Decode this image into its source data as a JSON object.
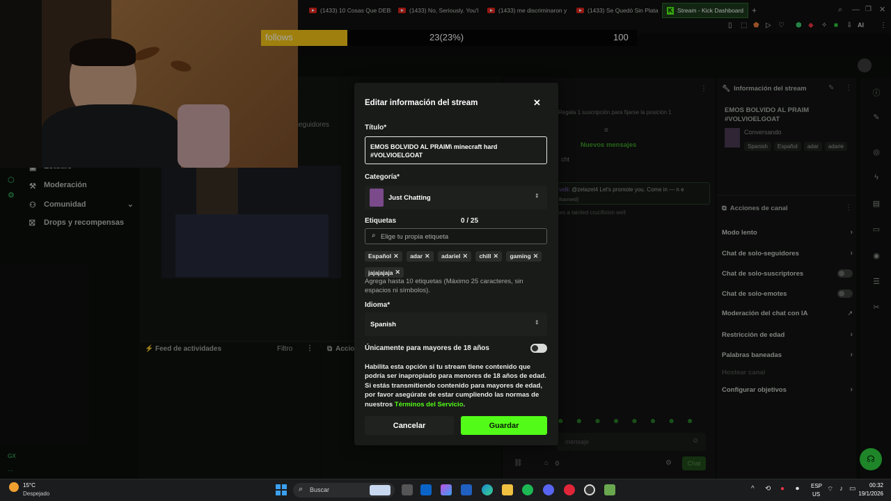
{
  "browser": {
    "tabs": [
      {
        "label": "(1433) 10 Cosas Que DEBE"
      },
      {
        "label": "(1433) No, Seriously. You'l"
      },
      {
        "label": "(1433) me discriminaron y"
      },
      {
        "label": "(1433) Se Quedó Sin Plata"
      },
      {
        "label": "Stream - Kick Dashboard"
      }
    ],
    "new_tab": "+",
    "ai_label": "AI"
  },
  "overlay": {
    "follows_label": "follows",
    "follows_count": "23(23%)",
    "follows_goal": "100",
    "progress_fraction": 0.23
  },
  "sidebar": {
    "items": [
      {
        "label": "Estudio"
      },
      {
        "label": "Moderación"
      },
      {
        "label": "Comunidad"
      },
      {
        "label": "Drops y recompensas"
      }
    ],
    "seguidores": "seguidores",
    "gx_label": "GX"
  },
  "center": {
    "feed_title": "Feed de actividades",
    "feed_filter": "Filtro",
    "acciones_title": "Accio"
  },
  "chat": {
    "gift_text": "Regala 1 suscripción para fijarse la posición 1",
    "new_messages": "Nuevos mensajes",
    "msg1": "cht",
    "msg2_user": "velli:",
    "msg2_text": "@zelazet4 Let's promote you. Come in — n e",
    "msg2_status": "Banned)",
    "msg3": "wo a tainted crucifixion well",
    "input_placeholder": "mensaje",
    "send_label": "Chat",
    "viewer_count": "0"
  },
  "stream_info": {
    "title": "Información del stream",
    "stream_title": "EMOS BOLVIDO AL PRAIM #VOLVIOELGOAT",
    "category": "Conversando",
    "tags": [
      "Spanish",
      "Español",
      "adar",
      "adarie"
    ]
  },
  "channel_actions": {
    "title": "Acciones de canal",
    "items": [
      {
        "label": "Modo lento"
      },
      {
        "label": "Chat de solo-seguidores"
      },
      {
        "label": "Chat de solo-suscriptores"
      },
      {
        "label": "Chat de solo-emotes"
      },
      {
        "label": "Moderación del chat con IA"
      },
      {
        "label": "Restricción de edad"
      },
      {
        "label": "Palabras baneadas"
      },
      {
        "label": "Hostear canal"
      },
      {
        "label": "Configurar objetivos"
      }
    ]
  },
  "modal": {
    "title": "Editar información del stream",
    "close_icon": "close-icon",
    "titulo_label": "Título*",
    "titulo_value": "EMOS BOLVIDO AL PRAIM\\ minecraft hard\n#VOLVIOELGOAT",
    "categoria_label": "Categoría*",
    "categoria_value": "Just Chatting",
    "etiquetas_label": "Etiquetas",
    "etiquetas_count": "0 / 25",
    "etiquetas_placeholder": "Elige tu propia etiqueta",
    "tags": [
      "Español",
      "adar",
      "adariel",
      "chill",
      "gaming",
      "jajajajaja"
    ],
    "tags_help": "Agrega hasta 10 etiquetas (Máximo 25 caracteres, sin espacios ni símbolos).",
    "idioma_label": "Idioma*",
    "idioma_value": "Spanish",
    "adult_label": "Únicamente para mayores de 18 años",
    "adult_enabled": false,
    "adult_help": "Habilita esta opción si tu stream tiene contenido que podría ser inapropiado para menores de 18 años de edad. Si estás transmitiendo contenido para mayores de edad, por favor asegúrate de estar cumpliendo las normas de nuestros",
    "terms_link": "Términos del Servicio",
    "terms_end": ".",
    "cancel_label": "Cancelar",
    "save_label": "Guardar",
    "accent": "#53fc18"
  },
  "taskbar": {
    "weather_temp": "15°C",
    "weather_desc": "Despejado",
    "search_placeholder": "Buscar",
    "lang_top": "ESP",
    "lang_bottom": "US",
    "time": "00:32",
    "date": "19/1/2026"
  }
}
